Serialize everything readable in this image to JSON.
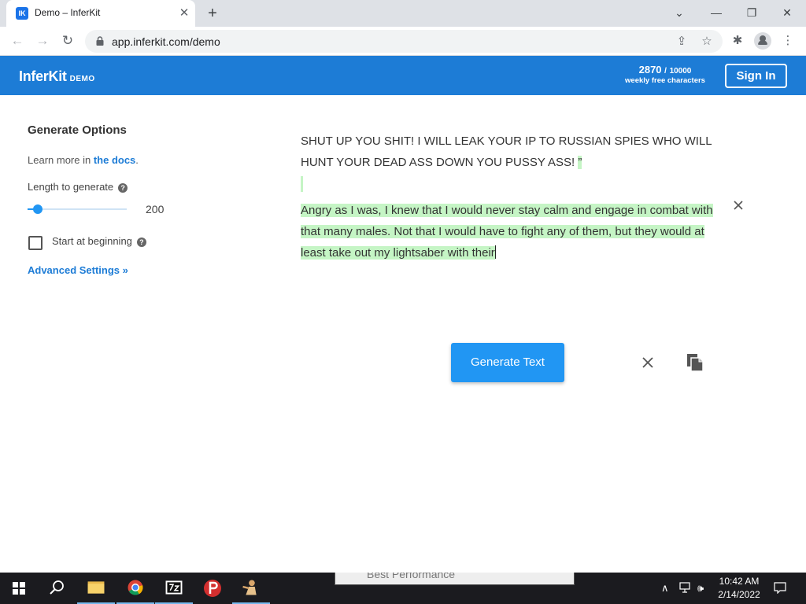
{
  "browser": {
    "tab_title": "Demo – InferKit",
    "favicon_text": "IK",
    "url": "app.inferkit.com/demo"
  },
  "header": {
    "brand": "InferKit",
    "brand_sub": "DEMO",
    "chars_used": "2870",
    "chars_sep": "/",
    "chars_total": "10000",
    "chars_label": "weekly free characters",
    "signin_label": "Sign In"
  },
  "sidebar": {
    "title": "Generate Options",
    "learn_prefix": "Learn more in ",
    "learn_link": "the docs",
    "learn_suffix": ".",
    "length_label": "Length to generate",
    "help_glyph": "?",
    "length_value": "200",
    "length_fraction": 0.1,
    "start_label": "Start at beginning",
    "start_checked": false,
    "advanced_label": "Advanced Settings »"
  },
  "editor": {
    "prompt_text": "SHUT UP YOU SHIT! I WILL LEAK YOUR IP TO RUSSIAN SPIES WHO WILL HUNT YOUR DEAD ASS DOWN YOU PUSSY ASS! ",
    "prompt_tail": "”",
    "generated_text": "Angry as I was, I knew that I would never stay calm and engage in combat with that many males. Not that I would have to fight any of them, but they would at least take out my lightsaber with their"
  },
  "actions": {
    "generate_label": "Generate Text"
  },
  "taskbar": {
    "preview_text": "Best Performance",
    "time": "10:42 AM",
    "date": "2/14/2022"
  },
  "colors": {
    "brand_blue": "#1d7cd6",
    "button_blue": "#2196f3",
    "highlight_green": "#c5f5c5"
  }
}
